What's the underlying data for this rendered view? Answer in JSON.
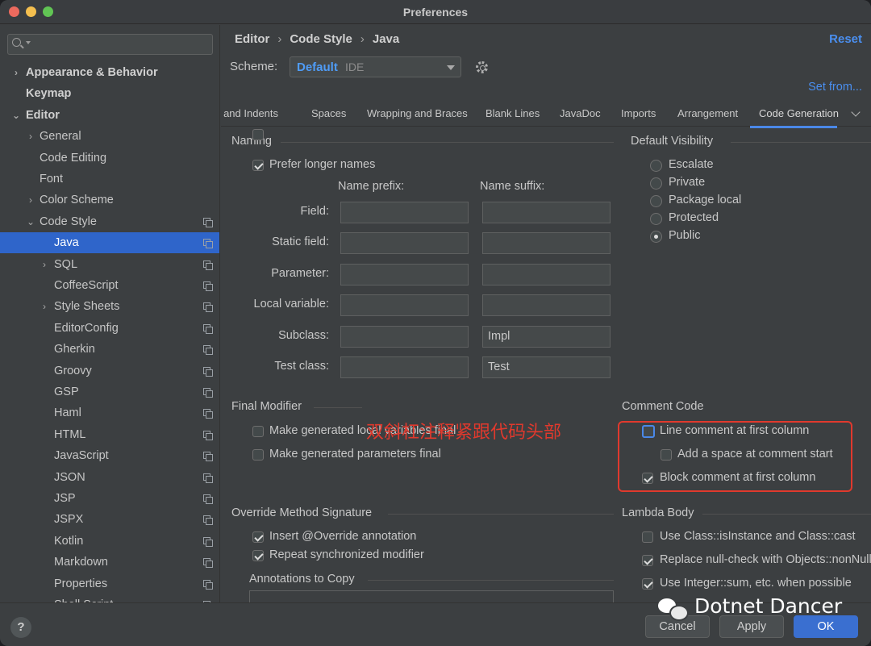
{
  "window": {
    "title": "Preferences"
  },
  "sidebar": {
    "search_placeholder": "",
    "items": [
      {
        "label": "Appearance & Behavior",
        "bold": true,
        "chevron": "›",
        "indent": 0
      },
      {
        "label": "Keymap",
        "bold": true,
        "chevron": "",
        "indent": 0
      },
      {
        "label": "Editor",
        "bold": true,
        "chevron": "⌄",
        "indent": 0
      },
      {
        "label": "General",
        "bold": false,
        "chevron": "›",
        "indent": 1
      },
      {
        "label": "Code Editing",
        "bold": false,
        "chevron": "",
        "indent": 1
      },
      {
        "label": "Font",
        "bold": false,
        "chevron": "",
        "indent": 1
      },
      {
        "label": "Color Scheme",
        "bold": false,
        "chevron": "›",
        "indent": 1
      },
      {
        "label": "Code Style",
        "bold": false,
        "chevron": "⌄",
        "indent": 1,
        "copy": true
      },
      {
        "label": "Java",
        "bold": false,
        "chevron": "",
        "indent": 2,
        "copy": true,
        "selected": true
      },
      {
        "label": "SQL",
        "bold": false,
        "chevron": "›",
        "indent": 2,
        "copy": true
      },
      {
        "label": "CoffeeScript",
        "bold": false,
        "chevron": "",
        "indent": 2,
        "copy": true
      },
      {
        "label": "Style Sheets",
        "bold": false,
        "chevron": "›",
        "indent": 2,
        "copy": true
      },
      {
        "label": "EditorConfig",
        "bold": false,
        "chevron": "",
        "indent": 2,
        "copy": true
      },
      {
        "label": "Gherkin",
        "bold": false,
        "chevron": "",
        "indent": 2,
        "copy": true
      },
      {
        "label": "Groovy",
        "bold": false,
        "chevron": "",
        "indent": 2,
        "copy": true
      },
      {
        "label": "GSP",
        "bold": false,
        "chevron": "",
        "indent": 2,
        "copy": true
      },
      {
        "label": "Haml",
        "bold": false,
        "chevron": "",
        "indent": 2,
        "copy": true
      },
      {
        "label": "HTML",
        "bold": false,
        "chevron": "",
        "indent": 2,
        "copy": true
      },
      {
        "label": "JavaScript",
        "bold": false,
        "chevron": "",
        "indent": 2,
        "copy": true
      },
      {
        "label": "JSON",
        "bold": false,
        "chevron": "",
        "indent": 2,
        "copy": true
      },
      {
        "label": "JSP",
        "bold": false,
        "chevron": "",
        "indent": 2,
        "copy": true
      },
      {
        "label": "JSPX",
        "bold": false,
        "chevron": "",
        "indent": 2,
        "copy": true
      },
      {
        "label": "Kotlin",
        "bold": false,
        "chevron": "",
        "indent": 2,
        "copy": true
      },
      {
        "label": "Markdown",
        "bold": false,
        "chevron": "",
        "indent": 2,
        "copy": true
      },
      {
        "label": "Properties",
        "bold": false,
        "chevron": "",
        "indent": 2,
        "copy": true
      },
      {
        "label": "Shell Script",
        "bold": false,
        "chevron": "",
        "indent": 2,
        "copy": true
      }
    ]
  },
  "header": {
    "breadcrumb": [
      "Editor",
      "Code Style",
      "Java"
    ],
    "breadcrumb_sep": "›",
    "reset_label": "Reset",
    "scheme_label": "Scheme:",
    "scheme_value": "Default",
    "scheme_scope": "IDE",
    "set_from_label": "Set from..."
  },
  "tabs": [
    {
      "label": "Tabs and Indents",
      "active": false
    },
    {
      "label": "Spaces",
      "active": false
    },
    {
      "label": "Wrapping and Braces",
      "active": false
    },
    {
      "label": "Blank Lines",
      "active": false
    },
    {
      "label": "JavaDoc",
      "active": false
    },
    {
      "label": "Imports",
      "active": false
    },
    {
      "label": "Arrangement",
      "active": false
    },
    {
      "label": "Code Generation",
      "active": true
    }
  ],
  "naming": {
    "title": "Naming",
    "prefer_longer": {
      "label": "Prefer longer names",
      "checked": true
    },
    "prefix_header": "Name prefix:",
    "suffix_header": "Name suffix:",
    "rows": [
      {
        "label": "Field:",
        "prefix": "",
        "suffix": ""
      },
      {
        "label": "Static field:",
        "prefix": "",
        "suffix": ""
      },
      {
        "label": "Parameter:",
        "prefix": "",
        "suffix": ""
      },
      {
        "label": "Local variable:",
        "prefix": "",
        "suffix": ""
      },
      {
        "label": "Subclass:",
        "prefix": "",
        "suffix": "Impl"
      },
      {
        "label": "Test class:",
        "prefix": "",
        "suffix": "Test"
      }
    ]
  },
  "default_visibility": {
    "title": "Default Visibility",
    "options": [
      {
        "label": "Escalate",
        "checked": false
      },
      {
        "label": "Private",
        "checked": false
      },
      {
        "label": "Package local",
        "checked": false
      },
      {
        "label": "Protected",
        "checked": false
      },
      {
        "label": "Public",
        "checked": true
      }
    ]
  },
  "final_modifier": {
    "title": "Final Modifier",
    "items": [
      {
        "label": "Make generated local variables final",
        "checked": false
      },
      {
        "label": "Make generated parameters final",
        "checked": false
      }
    ]
  },
  "annotation_text": "双斜杠注释紧跟代码头部",
  "comment_code": {
    "title": "Comment Code",
    "line_comment": {
      "label": "Line comment at first column",
      "checked": false
    },
    "add_space": {
      "label": "Add a space at comment start",
      "checked": false
    },
    "block_comment": {
      "label": "Block comment at first column",
      "checked": true
    }
  },
  "override": {
    "title": "Override Method Signature",
    "items": [
      {
        "label": "Insert @Override annotation",
        "checked": true
      },
      {
        "label": "Repeat synchronized modifier",
        "checked": true
      }
    ],
    "annotations_title": "Annotations to Copy"
  },
  "lambda": {
    "title": "Lambda Body",
    "items": [
      {
        "label": "Use Class::isInstance and Class::cast",
        "checked": false
      },
      {
        "label": "Replace null-check with Objects::nonNull",
        "checked": true
      },
      {
        "label": "Use Integer::sum, etc. when possible",
        "checked": true
      }
    ]
  },
  "footer": {
    "help_label": "?",
    "cancel_label": "Cancel",
    "apply_label": "Apply",
    "ok_label": "OK",
    "watermark": "Dotnet Dancer"
  },
  "colors": {
    "accent": "#2f65ca",
    "link": "#4a8ff0",
    "annotation": "#e0392d"
  }
}
